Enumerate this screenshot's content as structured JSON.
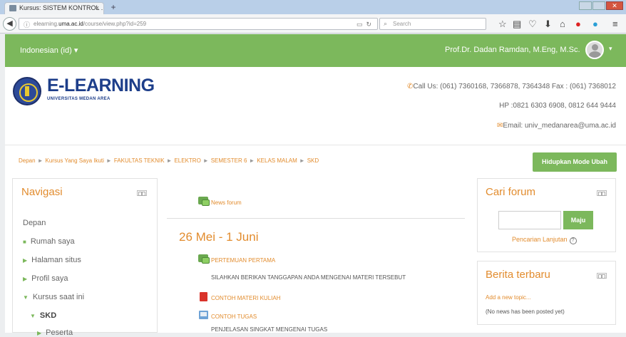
{
  "browser": {
    "tab_title": "Kursus: SISTEM KONTROL ...",
    "tab_close": "×",
    "new_tab": "+",
    "url_prefix": "elearning.",
    "url_domain": "uma.ac.id",
    "url_path": "/course/view.php?id=259",
    "search_placeholder": "Search"
  },
  "topbar": {
    "language": "Indonesian (id) ▾",
    "user_name": "Prof.Dr. Dadan Ramdan, M.Eng, M.Sc.",
    "caret": "▾"
  },
  "header": {
    "logo_title": "E-LEARNING",
    "logo_subtitle": "UNIVERSITAS MEDAN AREA",
    "phone": "Call Us: (061) 7360168, 7366878, 7364348 Fax : (061) 7368012",
    "hp": "HP :0821 6303 6908, 0812 644 9444",
    "email": "Email: univ_medanarea@uma.ac.id"
  },
  "breadcrumb": [
    "Depan",
    "Kursus Yang Saya Ikuti",
    "FAKULTAS TEKNIK",
    "ELEKTRO",
    "SEMESTER 6",
    "KELAS MALAM",
    "SKD"
  ],
  "breadcrumb_sep": "►",
  "edit_button": "Hidupkan Mode Ubah",
  "navigation": {
    "title": "Navigasi",
    "items": [
      "Depan",
      "Rumah saya",
      "Halaman situs",
      "Profil saya",
      "Kursus saat ini",
      "SKD",
      "Peserta"
    ]
  },
  "main": {
    "news_forum": "News forum",
    "section_title": "26 Mei - 1 Juni",
    "meeting": "PERTEMUAN PERTAMA",
    "meeting_desc": "SILAHKAN BERIKAN TANGGAPAN ANDA MENGENAI MATERI TERSEBUT",
    "material": "CONTOH MATERI KULIAH",
    "assignment": "CONTOH TUGAS",
    "assignment_desc": "PENJELASAN SINGKAT MENGENAI TUGAS"
  },
  "search_forum": {
    "title": "Cari forum",
    "button": "Maju",
    "advanced": "Pencarian Lanjutan"
  },
  "latest_news": {
    "title": "Berita terbaru",
    "add_topic": "Add a new topic...",
    "empty": "(No news has been posted yet)"
  },
  "colors": {
    "accent_green": "#7cb85c",
    "link_orange": "#e28c2e",
    "brand_blue": "#1d3e8a"
  }
}
